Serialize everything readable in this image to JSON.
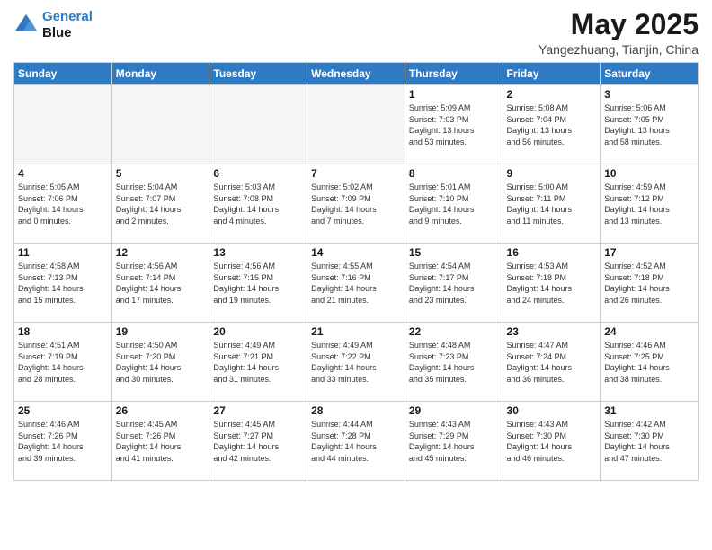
{
  "header": {
    "logo_line1": "General",
    "logo_line2": "Blue",
    "main_title": "May 2025",
    "subtitle": "Yangezhuang, Tianjin, China"
  },
  "weekdays": [
    "Sunday",
    "Monday",
    "Tuesday",
    "Wednesday",
    "Thursday",
    "Friday",
    "Saturday"
  ],
  "weeks": [
    [
      {
        "day": "",
        "info": ""
      },
      {
        "day": "",
        "info": ""
      },
      {
        "day": "",
        "info": ""
      },
      {
        "day": "",
        "info": ""
      },
      {
        "day": "1",
        "info": "Sunrise: 5:09 AM\nSunset: 7:03 PM\nDaylight: 13 hours\nand 53 minutes."
      },
      {
        "day": "2",
        "info": "Sunrise: 5:08 AM\nSunset: 7:04 PM\nDaylight: 13 hours\nand 56 minutes."
      },
      {
        "day": "3",
        "info": "Sunrise: 5:06 AM\nSunset: 7:05 PM\nDaylight: 13 hours\nand 58 minutes."
      }
    ],
    [
      {
        "day": "4",
        "info": "Sunrise: 5:05 AM\nSunset: 7:06 PM\nDaylight: 14 hours\nand 0 minutes."
      },
      {
        "day": "5",
        "info": "Sunrise: 5:04 AM\nSunset: 7:07 PM\nDaylight: 14 hours\nand 2 minutes."
      },
      {
        "day": "6",
        "info": "Sunrise: 5:03 AM\nSunset: 7:08 PM\nDaylight: 14 hours\nand 4 minutes."
      },
      {
        "day": "7",
        "info": "Sunrise: 5:02 AM\nSunset: 7:09 PM\nDaylight: 14 hours\nand 7 minutes."
      },
      {
        "day": "8",
        "info": "Sunrise: 5:01 AM\nSunset: 7:10 PM\nDaylight: 14 hours\nand 9 minutes."
      },
      {
        "day": "9",
        "info": "Sunrise: 5:00 AM\nSunset: 7:11 PM\nDaylight: 14 hours\nand 11 minutes."
      },
      {
        "day": "10",
        "info": "Sunrise: 4:59 AM\nSunset: 7:12 PM\nDaylight: 14 hours\nand 13 minutes."
      }
    ],
    [
      {
        "day": "11",
        "info": "Sunrise: 4:58 AM\nSunset: 7:13 PM\nDaylight: 14 hours\nand 15 minutes."
      },
      {
        "day": "12",
        "info": "Sunrise: 4:56 AM\nSunset: 7:14 PM\nDaylight: 14 hours\nand 17 minutes."
      },
      {
        "day": "13",
        "info": "Sunrise: 4:56 AM\nSunset: 7:15 PM\nDaylight: 14 hours\nand 19 minutes."
      },
      {
        "day": "14",
        "info": "Sunrise: 4:55 AM\nSunset: 7:16 PM\nDaylight: 14 hours\nand 21 minutes."
      },
      {
        "day": "15",
        "info": "Sunrise: 4:54 AM\nSunset: 7:17 PM\nDaylight: 14 hours\nand 23 minutes."
      },
      {
        "day": "16",
        "info": "Sunrise: 4:53 AM\nSunset: 7:18 PM\nDaylight: 14 hours\nand 24 minutes."
      },
      {
        "day": "17",
        "info": "Sunrise: 4:52 AM\nSunset: 7:18 PM\nDaylight: 14 hours\nand 26 minutes."
      }
    ],
    [
      {
        "day": "18",
        "info": "Sunrise: 4:51 AM\nSunset: 7:19 PM\nDaylight: 14 hours\nand 28 minutes."
      },
      {
        "day": "19",
        "info": "Sunrise: 4:50 AM\nSunset: 7:20 PM\nDaylight: 14 hours\nand 30 minutes."
      },
      {
        "day": "20",
        "info": "Sunrise: 4:49 AM\nSunset: 7:21 PM\nDaylight: 14 hours\nand 31 minutes."
      },
      {
        "day": "21",
        "info": "Sunrise: 4:49 AM\nSunset: 7:22 PM\nDaylight: 14 hours\nand 33 minutes."
      },
      {
        "day": "22",
        "info": "Sunrise: 4:48 AM\nSunset: 7:23 PM\nDaylight: 14 hours\nand 35 minutes."
      },
      {
        "day": "23",
        "info": "Sunrise: 4:47 AM\nSunset: 7:24 PM\nDaylight: 14 hours\nand 36 minutes."
      },
      {
        "day": "24",
        "info": "Sunrise: 4:46 AM\nSunset: 7:25 PM\nDaylight: 14 hours\nand 38 minutes."
      }
    ],
    [
      {
        "day": "25",
        "info": "Sunrise: 4:46 AM\nSunset: 7:26 PM\nDaylight: 14 hours\nand 39 minutes."
      },
      {
        "day": "26",
        "info": "Sunrise: 4:45 AM\nSunset: 7:26 PM\nDaylight: 14 hours\nand 41 minutes."
      },
      {
        "day": "27",
        "info": "Sunrise: 4:45 AM\nSunset: 7:27 PM\nDaylight: 14 hours\nand 42 minutes."
      },
      {
        "day": "28",
        "info": "Sunrise: 4:44 AM\nSunset: 7:28 PM\nDaylight: 14 hours\nand 44 minutes."
      },
      {
        "day": "29",
        "info": "Sunrise: 4:43 AM\nSunset: 7:29 PM\nDaylight: 14 hours\nand 45 minutes."
      },
      {
        "day": "30",
        "info": "Sunrise: 4:43 AM\nSunset: 7:30 PM\nDaylight: 14 hours\nand 46 minutes."
      },
      {
        "day": "31",
        "info": "Sunrise: 4:42 AM\nSunset: 7:30 PM\nDaylight: 14 hours\nand 47 minutes."
      }
    ]
  ]
}
